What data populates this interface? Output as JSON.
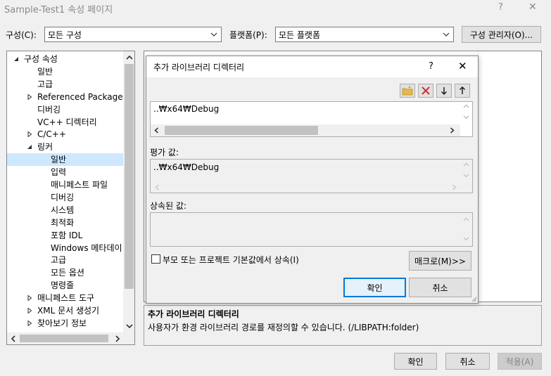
{
  "window": {
    "title": "Sample-Test1 속성 페이지",
    "help": "?",
    "close": "✕"
  },
  "toolbar": {
    "config_label": "구성(C):",
    "config_value": "모든 구성",
    "platform_label": "플랫폼(P):",
    "platform_value": "모든 플랫폼",
    "config_manager": "구성 관리자(O)..."
  },
  "tree": {
    "items": [
      {
        "label": "구성 속성",
        "expander": "expanded"
      },
      {
        "label": "일반"
      },
      {
        "label": "고급"
      },
      {
        "label": "Referenced Packages",
        "expander": "collapsed"
      },
      {
        "label": "디버깅"
      },
      {
        "label": "VC++ 디렉터리"
      },
      {
        "label": "C/C++",
        "expander": "collapsed"
      },
      {
        "label": "링커",
        "expander": "expanded"
      },
      {
        "label": "일반",
        "selected": true
      },
      {
        "label": "입력"
      },
      {
        "label": "매니페스트 파일"
      },
      {
        "label": "디버깅"
      },
      {
        "label": "시스템"
      },
      {
        "label": "최적화"
      },
      {
        "label": "포함 IDL"
      },
      {
        "label": "Windows 메타데이"
      },
      {
        "label": "고급"
      },
      {
        "label": "모든 옵션"
      },
      {
        "label": "명령줄"
      },
      {
        "label": "매니페스트 도구",
        "expander": "collapsed"
      },
      {
        "label": "XML 문서 생성기",
        "expander": "collapsed"
      },
      {
        "label": "찾아보기 정보",
        "expander": "collapsed"
      }
    ]
  },
  "description": {
    "title": "추가 라이브러리 디렉터리",
    "text": "사용자가 환경 라이브러리 경로를 재정의할 수 있습니다. (/LIBPATH:folder)"
  },
  "footer": {
    "ok": "확인",
    "cancel": "취소",
    "apply": "적용(A)"
  },
  "dialog": {
    "title": "추가 라이브러리 디렉터리",
    "help": "?",
    "close": "✕",
    "entry_value": "..₩x64₩Debug",
    "evaluated_label": "평가 값:",
    "evaluated_value": "..₩x64₩Debug",
    "inherited_label": "상속된 값:",
    "inherit_checkbox": "부모 또는 프로젝트 기본값에서 상속(I)",
    "inherit_checked": false,
    "macros_button": "매크로(M)>>",
    "ok": "확인",
    "cancel": "취소",
    "colors": {
      "delete_icon": "#d32f2f",
      "folder_icon": "#e8b84a",
      "selection": "#cde8ff"
    }
  }
}
